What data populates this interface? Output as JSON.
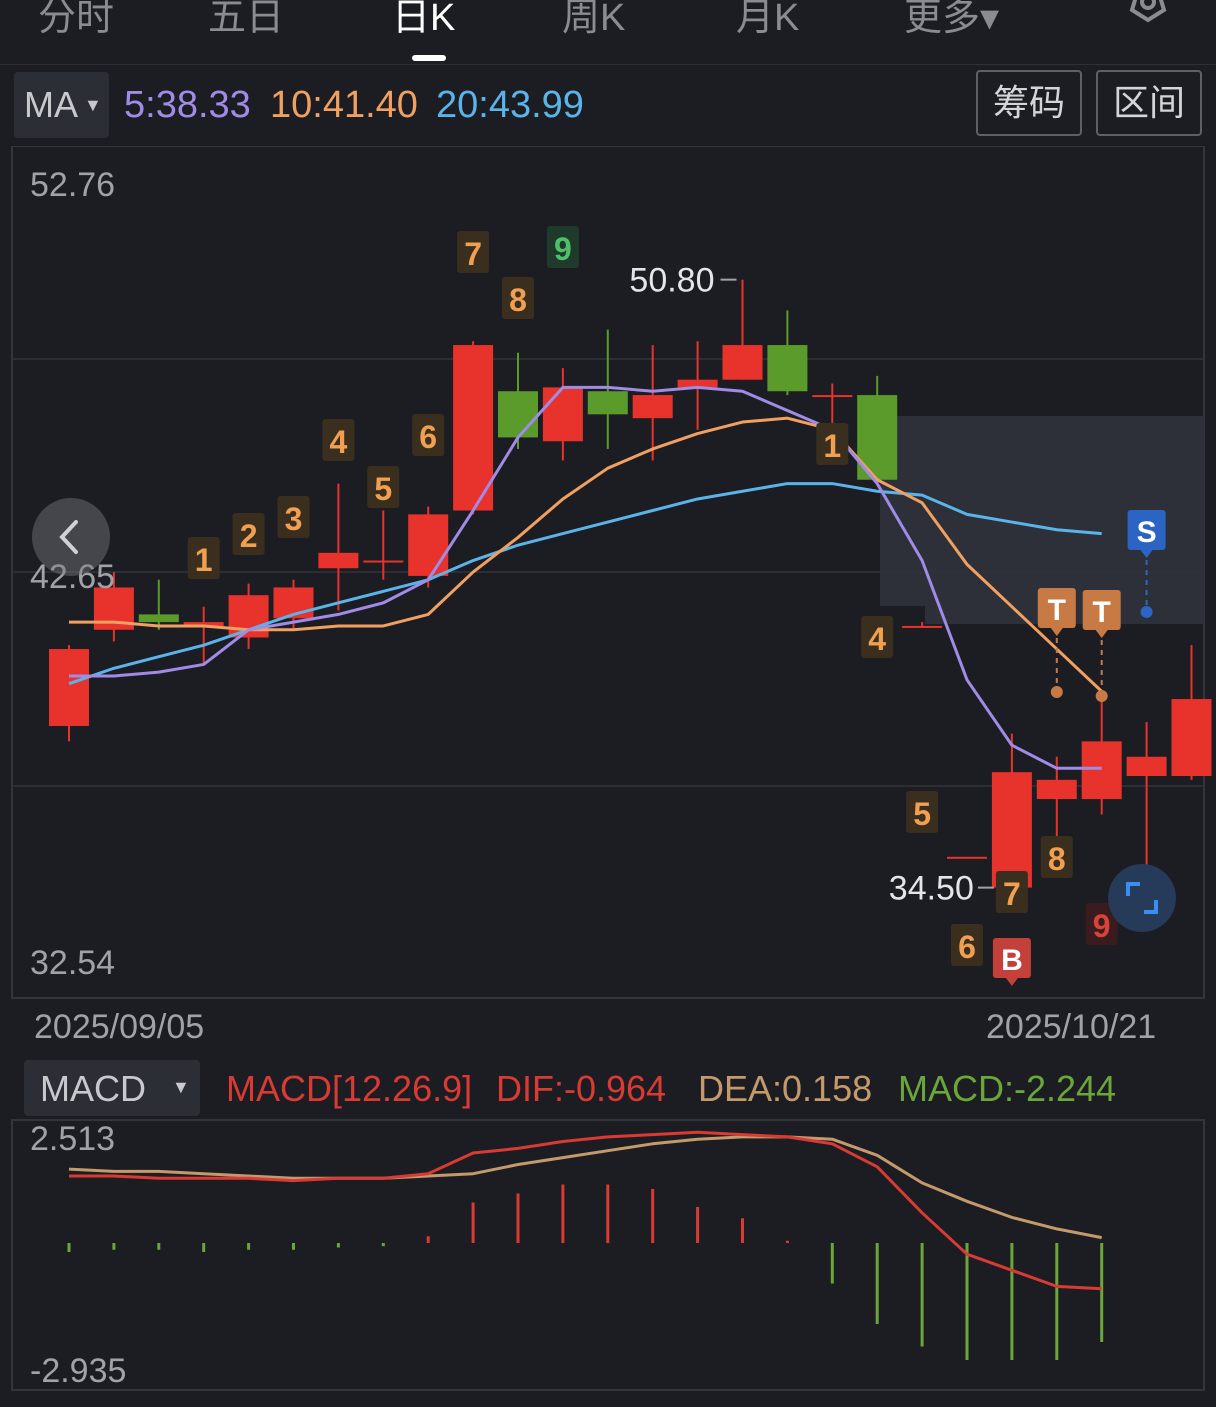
{
  "tabs": [
    {
      "label": "分时"
    },
    {
      "label": "五日"
    },
    {
      "label": "日K",
      "active": true
    },
    {
      "label": "周K"
    },
    {
      "label": "月K"
    },
    {
      "label": "更多▾"
    }
  ],
  "icons": {
    "settings": "gear-icon",
    "nav": "chevron-left-icon",
    "expand": "expand-corners-icon"
  },
  "ma_bar": {
    "selector": "MA",
    "ma5": "5:38.33",
    "ma10": "10:41.40",
    "ma20": "20:43.99",
    "btn_chip": "筹码",
    "btn_range": "区间"
  },
  "colors": {
    "up": "#e8322c",
    "down": "#5b9b2c",
    "ma5": "#a08be6",
    "ma10": "#f0a060",
    "ma20": "#5ab4ea",
    "dif": "#d93a34",
    "dea": "#c49a6c",
    "macd_text": "#6aa63a",
    "marker": "#f0a050"
  },
  "chart_data": {
    "type": "candlestick",
    "dates": [
      "2025/09/05",
      "2025/10/21"
    ],
    "y_axis_labels": [
      "52.76",
      "42.65",
      "32.54"
    ],
    "ylim": [
      32.54,
      52.76
    ],
    "high_label": "50.80",
    "low_label": "34.50",
    "candles": [
      {
        "o": 38.7,
        "c": 40.7,
        "h": 40.8,
        "l": 38.3
      },
      {
        "o": 41.2,
        "c": 42.3,
        "h": 42.7,
        "l": 40.9
      },
      {
        "o": 41.6,
        "c": 41.4,
        "h": 42.5,
        "l": 41.2
      },
      {
        "o": 41.3,
        "c": 41.4,
        "h": 41.8,
        "l": 40.3
      },
      {
        "o": 41.0,
        "c": 42.1,
        "h": 42.4,
        "l": 40.7
      },
      {
        "o": 41.5,
        "c": 42.3,
        "h": 42.5,
        "l": 41.2
      },
      {
        "o": 42.8,
        "c": 43.2,
        "h": 45.0,
        "l": 41.7
      },
      {
        "o": 43.0,
        "c": 43.0,
        "h": 44.3,
        "l": 42.5
      },
      {
        "o": 42.6,
        "c": 44.2,
        "h": 44.4,
        "l": 42.3
      },
      {
        "o": 44.3,
        "c": 48.6,
        "h": 48.7,
        "l": 44.2
      },
      {
        "o": 47.4,
        "c": 46.2,
        "h": 48.4,
        "l": 45.9
      },
      {
        "o": 46.1,
        "c": 47.5,
        "h": 48.0,
        "l": 45.6
      },
      {
        "o": 47.4,
        "c": 46.8,
        "h": 49.0,
        "l": 45.9
      },
      {
        "o": 46.7,
        "c": 47.3,
        "h": 48.6,
        "l": 45.6
      },
      {
        "o": 47.5,
        "c": 47.7,
        "h": 48.7,
        "l": 46.4
      },
      {
        "o": 47.7,
        "c": 48.6,
        "h": 50.3,
        "l": 47.7
      },
      {
        "o": 48.6,
        "c": 47.4,
        "h": 49.5,
        "l": 47.3
      },
      {
        "o": 47.3,
        "c": 47.3,
        "h": 47.6,
        "l": 46.4
      },
      {
        "o": 47.3,
        "c": 45.1,
        "h": 47.8,
        "l": 45.0
      },
      {
        "o": 41.3,
        "c": 41.3,
        "h": 41.4,
        "l": 41.3
      },
      {
        "o": 35.3,
        "c": 35.3,
        "h": 35.3,
        "l": 35.3
      },
      {
        "o": 34.5,
        "c": 37.5,
        "h": 38.5,
        "l": 34.5
      },
      {
        "o": 36.8,
        "c": 37.3,
        "h": 37.9,
        "l": 35.0
      },
      {
        "o": 36.8,
        "c": 38.3,
        "h": 39.4,
        "l": 36.4
      },
      {
        "o": 37.4,
        "c": 37.9,
        "h": 38.8,
        "l": 35.0
      },
      {
        "o": 37.4,
        "c": 39.4,
        "h": 40.8,
        "l": 37.3
      }
    ],
    "ma5": [
      40.0,
      40.0,
      40.1,
      40.3,
      41.2,
      41.4,
      41.6,
      41.9,
      42.5,
      44.3,
      46.2,
      47.5,
      47.5,
      47.4,
      47.5,
      47.4,
      46.9,
      46.4,
      45.0,
      43.0,
      39.9,
      38.2,
      37.6,
      37.6
    ],
    "ma10": [
      41.4,
      41.4,
      41.3,
      41.3,
      41.2,
      41.2,
      41.3,
      41.3,
      41.6,
      42.7,
      43.6,
      44.6,
      45.4,
      45.9,
      46.3,
      46.6,
      46.7,
      46.4,
      45.1,
      44.5,
      42.9,
      41.8,
      40.7,
      39.6
    ],
    "ma20": [
      39.8,
      40.2,
      40.5,
      40.8,
      41.2,
      41.6,
      41.9,
      42.2,
      42.5,
      43.0,
      43.4,
      43.7,
      44.0,
      44.3,
      44.6,
      44.8,
      45.0,
      45.0,
      44.8,
      44.7,
      44.2,
      44.0,
      43.8,
      43.7
    ],
    "seq_labels": [
      {
        "i": 3,
        "t": "1"
      },
      {
        "i": 4,
        "t": "2"
      },
      {
        "i": 5,
        "t": "3"
      },
      {
        "i": 6,
        "t": "4"
      },
      {
        "i": 7,
        "t": "5"
      },
      {
        "i": 8,
        "t": "6"
      },
      {
        "i": 9,
        "t": "7"
      },
      {
        "i": 10,
        "t": "8"
      },
      {
        "i": 11,
        "t": "9"
      },
      {
        "i": 17,
        "t": "1"
      },
      {
        "i": 18,
        "t": "4"
      },
      {
        "i": 19,
        "t": "5"
      },
      {
        "i": 20,
        "t": "6"
      },
      {
        "i": 21,
        "t": "7"
      },
      {
        "i": 22,
        "t": "8"
      },
      {
        "i": 23,
        "t": "9"
      }
    ],
    "signals": [
      {
        "i": 21,
        "t": "B"
      },
      {
        "i": 22,
        "t": "T"
      },
      {
        "i": 23,
        "t": "T"
      },
      {
        "i": 24,
        "t": "S"
      }
    ]
  },
  "macd": {
    "selector": "MACD",
    "params": "MACD[12.26.9]",
    "dif": "DIF:-0.964",
    "dea": "DEA:0.158",
    "macd": "MACD:-2.244",
    "y_max": "2.513",
    "y_min": "-2.935",
    "hist": [
      -0.2,
      -0.15,
      -0.15,
      -0.2,
      -0.15,
      -0.15,
      -0.1,
      -0.07,
      0.15,
      0.9,
      1.1,
      1.3,
      1.3,
      1.2,
      0.8,
      0.55,
      0.05,
      -0.9,
      -1.8,
      -2.3,
      -2.6,
      -2.6,
      -2.6,
      -2.2
    ],
    "dif_line": [
      1.5,
      1.5,
      1.45,
      1.45,
      1.45,
      1.4,
      1.45,
      1.45,
      1.55,
      2.0,
      2.1,
      2.25,
      2.35,
      2.4,
      2.45,
      2.4,
      2.35,
      2.2,
      1.7,
      0.7,
      -0.2,
      -0.55,
      -0.9,
      -0.95
    ],
    "dea_line": [
      1.65,
      1.6,
      1.6,
      1.55,
      1.5,
      1.45,
      1.45,
      1.45,
      1.5,
      1.55,
      1.75,
      1.9,
      2.05,
      2.2,
      2.3,
      2.35,
      2.35,
      2.3,
      1.95,
      1.35,
      0.95,
      0.6,
      0.35,
      0.16
    ]
  }
}
